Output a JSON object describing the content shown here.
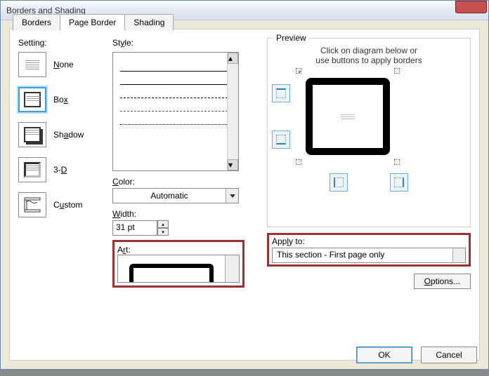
{
  "window": {
    "title": "Borders and Shading"
  },
  "tabs": {
    "borders": "Borders",
    "page_border": "Page Border",
    "shading": "Shading"
  },
  "setting": {
    "label": "Setting:",
    "none": "None",
    "box": "Box",
    "shadow": "Shadow",
    "threed": "3-D",
    "custom": "Custom"
  },
  "style": {
    "label": "Style:",
    "color_label": "Color:",
    "color_value": "Automatic",
    "width_label": "Width:",
    "width_value": "31 pt",
    "art_label": "Art:"
  },
  "preview": {
    "label": "Preview",
    "hint_line1": "Click on diagram below or",
    "hint_line2": "use buttons to apply borders"
  },
  "apply": {
    "label": "Apply to:",
    "value": "This section - First page only"
  },
  "buttons": {
    "options": "Options...",
    "ok": "OK",
    "cancel": "Cancel"
  }
}
